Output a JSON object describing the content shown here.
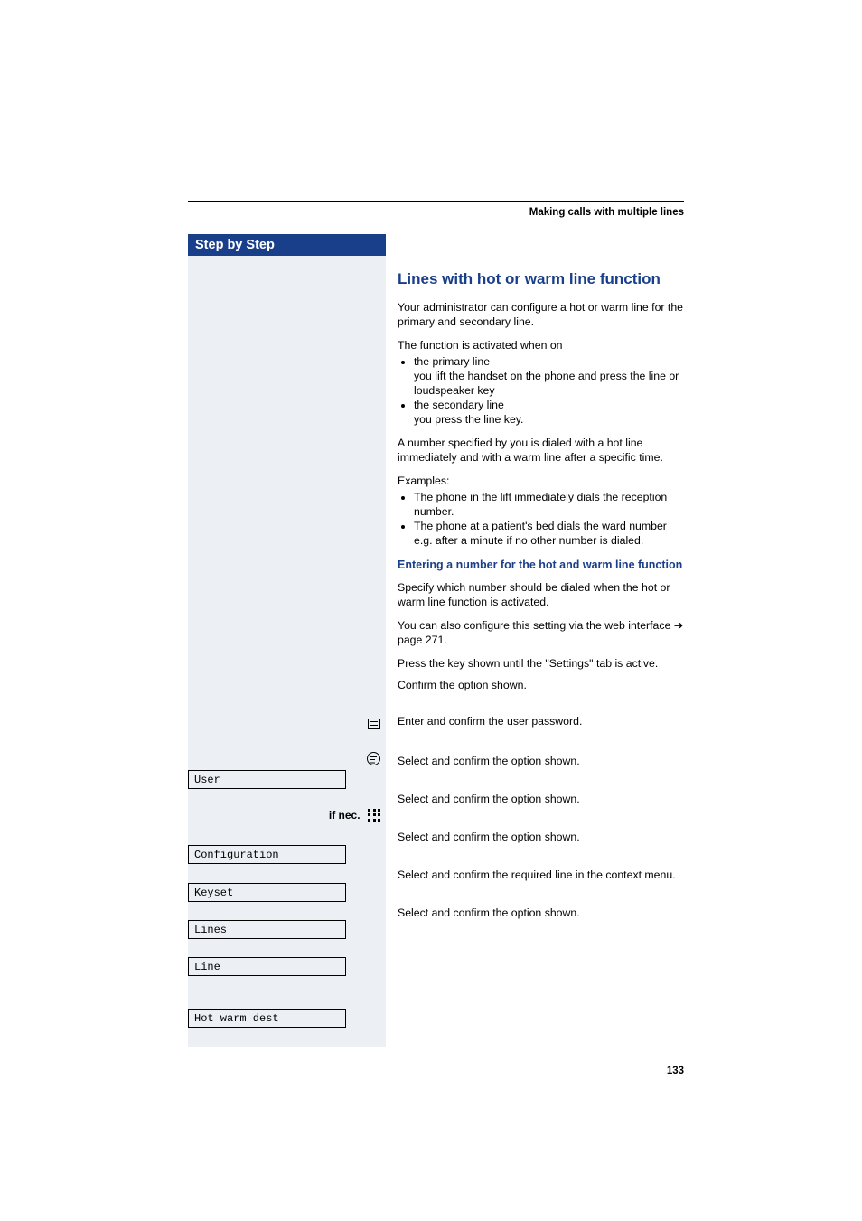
{
  "header": {
    "running_title": "Making calls with multiple lines"
  },
  "sidebar": {
    "title": "Step by Step",
    "ifnec_label": "if nec.",
    "menu_items": {
      "user": "User",
      "configuration": "Configuration",
      "keyset": "Keyset",
      "lines": "Lines",
      "line": "Line",
      "hot_warm_dest": "Hot warm dest"
    }
  },
  "content": {
    "section_title": "Lines with hot or warm line function",
    "intro_p1": "Your administrator can configure a hot or warm line for the primary and secondary line.",
    "activation_intro": "The function is activated when on",
    "activation_items": [
      {
        "head": "the primary line",
        "sub": "you lift the handset on the phone and press the line or loudspeaker key"
      },
      {
        "head": "the secondary line",
        "sub": "you press the line key."
      }
    ],
    "spec_p": "A number specified by you is dialed with a hot line immediately and with a warm line after a specific time.",
    "examples_intro": "Examples:",
    "examples": [
      "The phone in the lift immediately dials the reception number.",
      "The phone at a patient's bed dials the ward number e.g. after a minute if no other number is dialed."
    ],
    "subhead": "Entering a number for the hot and warm line function",
    "specify_p": "Specify which number should be dialed when the hot or warm line function is activated.",
    "web_p_prefix": "You can also configure this setting via the web interface ",
    "web_p_arrow": "➔",
    "web_p_page": " page 271.",
    "steps": {
      "press_key": "Press the key shown until the \"Settings\" tab is active.",
      "confirm_user": "Confirm the option shown.",
      "enter_pw": "Enter and confirm the user password.",
      "configuration": "Select and confirm the option shown.",
      "keyset": "Select and confirm the option shown.",
      "lines": "Select and confirm the option shown.",
      "line": "Select and confirm the required line in the context menu.",
      "hot_warm_dest": "Select and confirm the option shown."
    }
  },
  "page_number": "133"
}
